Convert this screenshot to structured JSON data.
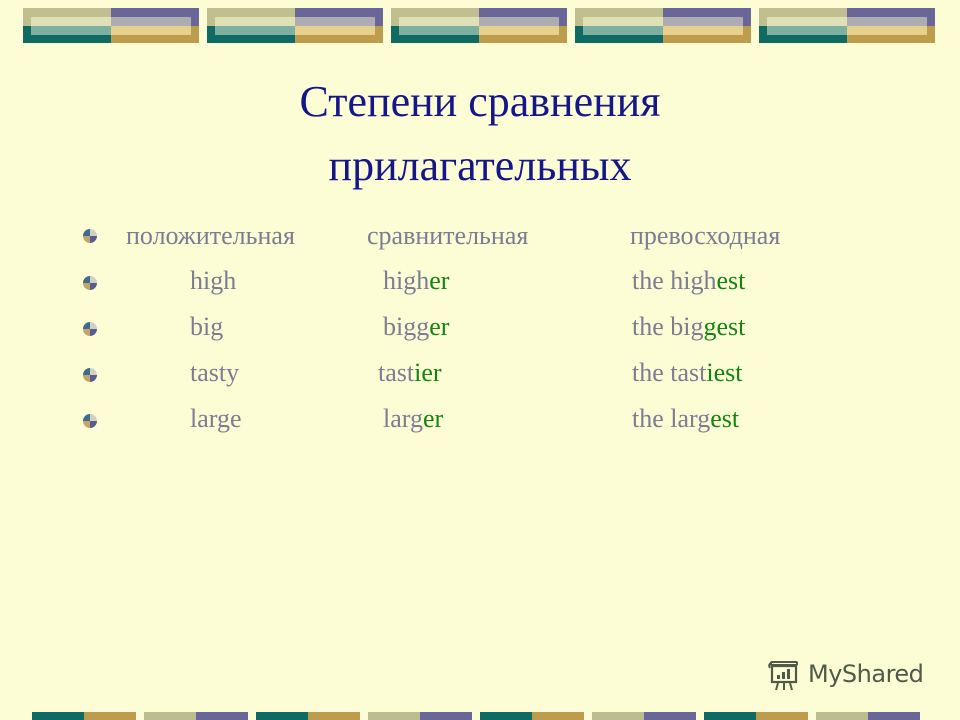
{
  "slide": {
    "title_line1": "Степени сравнения",
    "title_line2": "прилагательных",
    "colors": {
      "background": "#fdfdd5",
      "title": "#15168a",
      "body_text": "#7d7c93",
      "suffix_highlight": "#138313"
    }
  },
  "table": {
    "headers": [
      "положительная",
      "сравнительная",
      "превосходная"
    ],
    "rows": [
      {
        "positive": "high",
        "comparative_stem": "high",
        "comparative_suffix": "er",
        "superlative_stem": "the high",
        "superlative_suffix": "est"
      },
      {
        "positive": "big",
        "comparative_stem": "bigg",
        "comparative_suffix": "er",
        "superlative_stem": "the big",
        "superlative_suffix": "gest"
      },
      {
        "positive": "tasty",
        "comparative_stem": "tast",
        "comparative_suffix": "ier",
        "superlative_stem": "the tast",
        "superlative_suffix": "iest"
      },
      {
        "positive": "large",
        "comparative_stem": "larg",
        "comparative_suffix": "er",
        "superlative_stem": "the larg",
        "superlative_suffix": "est"
      }
    ]
  },
  "watermark": {
    "icon": "presentation-board-icon",
    "text": "MyShared"
  }
}
